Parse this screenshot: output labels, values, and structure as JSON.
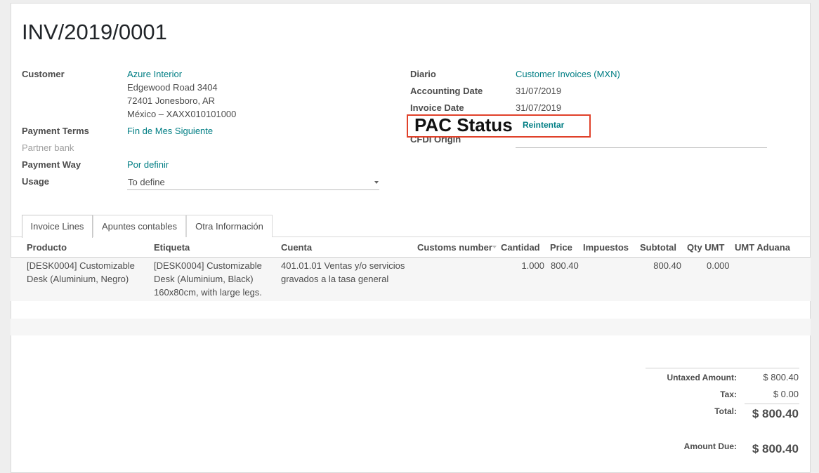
{
  "invoice": {
    "number": "INV/2019/0001"
  },
  "left_fields": {
    "customer_label": "Customer",
    "customer_name": "Azure Interior",
    "address_line1": "Edgewood Road 3404",
    "address_line2": "72401 Jonesboro, AR",
    "address_line3": "México – XAXX010101000",
    "payment_terms_label": "Payment Terms",
    "payment_terms_value": "Fin de Mes Siguiente",
    "partner_bank_label": "Partner bank",
    "payment_way_label": "Payment Way",
    "payment_way_value": "Por definir",
    "usage_label": "Usage",
    "usage_value": "To define"
  },
  "right_fields": {
    "diario_label": "Diario",
    "diario_value": "Customer Invoices (MXN)",
    "accounting_date_label": "Accounting Date",
    "accounting_date_value": "31/07/2019",
    "invoice_date_label": "Invoice Date",
    "invoice_date_value": "31/07/2019",
    "cfdi_origin_label": "CFDI Origin"
  },
  "pac": {
    "label": "PAC Status",
    "action": "Reintentar",
    "highlight_color": "#e0412a"
  },
  "tabs": [
    {
      "label": "Invoice Lines",
      "active": true
    },
    {
      "label": "Apuntes contables",
      "active": false
    },
    {
      "label": "Otra Información",
      "active": false
    }
  ],
  "table": {
    "columns": [
      "Producto",
      "Etiqueta",
      "Cuenta",
      "Customs number",
      "Cantidad",
      "Price",
      "Impuestos",
      "Subtotal",
      "Qty UMT",
      "UMT Aduana"
    ],
    "rows": [
      {
        "producto": [
          "[DESK0004] Customizable",
          "Desk (Aluminium, Negro)"
        ],
        "etiqueta": [
          "[DESK0004] Customizable",
          "Desk (Aluminium, Black)",
          "160x80cm, with large legs."
        ],
        "cuenta": [
          "401.01.01 Ventas y/o servicios",
          "gravados a la tasa general"
        ],
        "customs_number": "",
        "cantidad": "1.000",
        "price": "800.40",
        "impuestos": "",
        "subtotal": "800.40",
        "qty_umt": "0.000",
        "umt_aduana": ""
      }
    ]
  },
  "totals": {
    "untaxed_label": "Untaxed Amount:",
    "untaxed_value": "$ 800.40",
    "tax_label": "Tax:",
    "tax_value": "$ 0.00",
    "total_label": "Total:",
    "total_value": "$ 800.40",
    "amount_due_label": "Amount Due:",
    "amount_due_value": "$ 800.40"
  },
  "colors": {
    "link": "#017e84",
    "text": "#4c4c4c",
    "muted": "#a0a0a0"
  }
}
